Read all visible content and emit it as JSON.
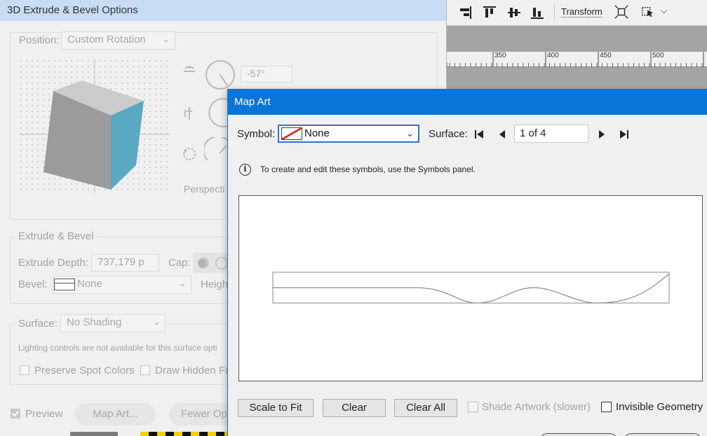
{
  "toolbar": {
    "transform_label": "Transform"
  },
  "ruler": {
    "ticks": [
      "350",
      "400",
      "450",
      "500"
    ]
  },
  "extrude_dialog": {
    "title": "3D Extrude & Bevel Options",
    "position_label": "Position:",
    "position_value": "Custom Rotation",
    "rotation_x_value": "-57°",
    "perspective_label": "Perspecti",
    "extrude_group_label": "Extrude & Bevel",
    "extrude_depth_label": "Extrude Depth:",
    "extrude_depth_value": "737,179 p",
    "cap_label": "Cap:",
    "bevel_label": "Bevel:",
    "bevel_value": "None",
    "height_label": "Heigh",
    "surface_label": "Surface:",
    "surface_value": "No Shading",
    "lighting_note": "Lighting controls are not available for this surface opti",
    "preserve_spot_label": "Preserve Spot Colors",
    "draw_hidden_label": "Draw Hidden Fa",
    "preview_label": "Preview",
    "map_art_button": "Map Art...",
    "fewer_options_button": "Fewer Opt"
  },
  "map_art_dialog": {
    "title": "Map Art",
    "symbol_label": "Symbol:",
    "symbol_value": "None",
    "surface_label": "Surface:",
    "surface_page": "1 of 4",
    "info_text": "To create and edit these symbols, use the Symbols panel.",
    "scale_to_fit_button": "Scale to Fit",
    "clear_button": "Clear",
    "clear_all_button": "Clear All",
    "shade_artwork_label": "Shade Artwork (slower)",
    "invisible_geometry_label": "Invisible Geometry"
  },
  "colors": {
    "title_bar_active": "#0a75d8",
    "title_bar_inactive": "#c8dcf3",
    "cube_top": "#c9c9c9",
    "cube_front": "#9a9a9a",
    "cube_side": "#5aa8c2"
  }
}
